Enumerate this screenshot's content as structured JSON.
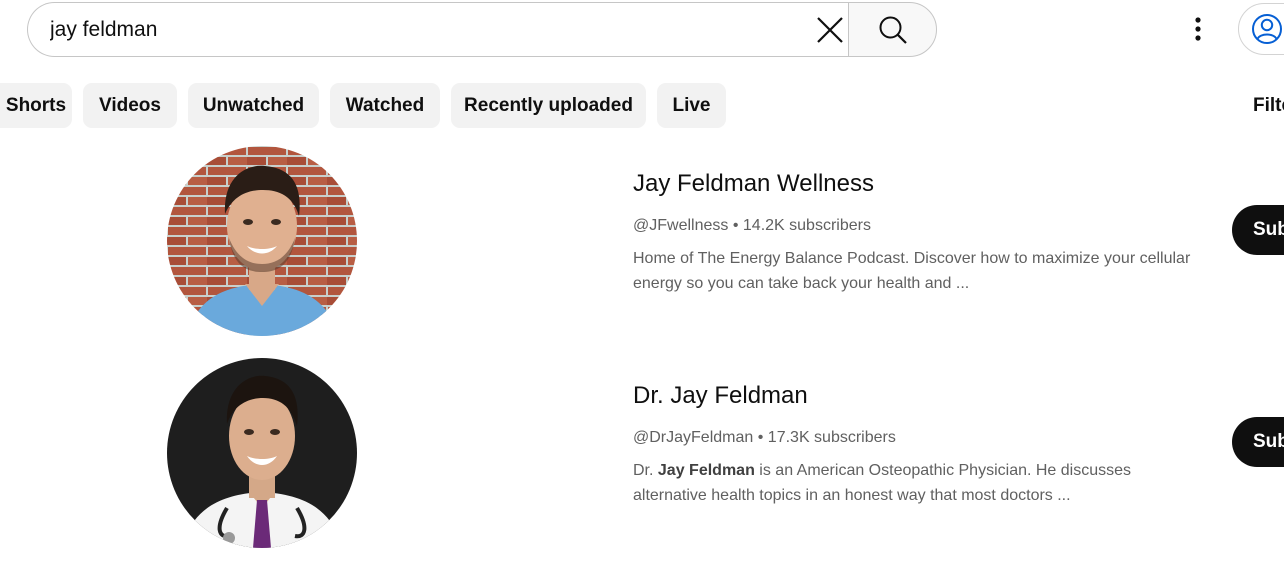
{
  "search": {
    "query": "jay feldman"
  },
  "filters": {
    "chips": [
      "Shorts",
      "Videos",
      "Unwatched",
      "Watched",
      "Recently uploaded",
      "Live"
    ],
    "filters_label": "Filters"
  },
  "results": [
    {
      "name": "Jay Feldman Wellness",
      "handle": "@JFwellness",
      "separator": "•",
      "subscribers": "14.2K subscribers",
      "description": "Home of The Energy Balance Podcast. Discover how to maximize your cellular energy so you can take back your health and ...",
      "subscribe_label": "Subscribe"
    },
    {
      "name": "Dr. Jay Feldman",
      "handle": "@DrJayFeldman",
      "separator": "•",
      "subscribers": "17.3K subscribers",
      "description_prefix": "Dr.",
      "description_bold": "Jay Feldman",
      "description_rest": "is an American Osteopathic Physician. He discusses alternative health topics in an honest way that most doctors ...",
      "subscribe_label": "Subscribe"
    }
  ],
  "icons": {
    "clear": "close-icon",
    "search": "search-icon",
    "more": "more-vert-icon",
    "account": "account-circle-icon"
  },
  "colors": {
    "primary_text": "#0f0f0f",
    "secondary_text": "#606060",
    "chip_bg": "#f2f2f2",
    "subscribe_bg": "#0f0f0f",
    "account_icon": "#065fd4"
  }
}
